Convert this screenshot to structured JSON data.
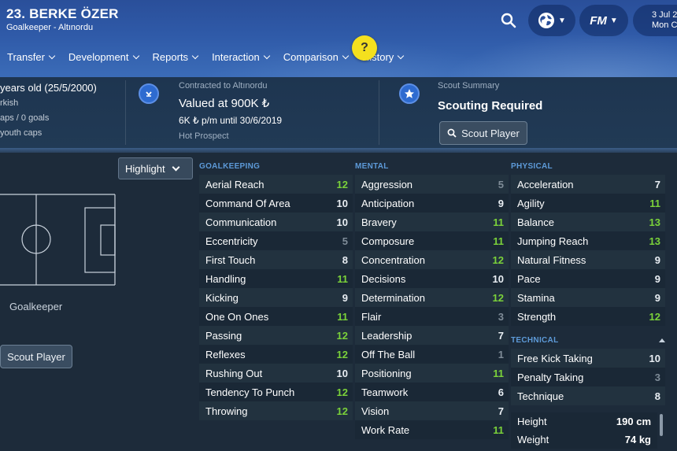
{
  "header": {
    "player_name": "23. BERKE ÖZER",
    "player_sub": "Goalkeeper - Altınordu",
    "date_line1": "3 Jul 2",
    "date_line2": "Mon C",
    "fm_label": "FM"
  },
  "nav": {
    "items": [
      "Transfer",
      "Development",
      "Reports",
      "Interaction",
      "Comparison",
      "History"
    ],
    "help": "?"
  },
  "info": {
    "age": "years old (25/5/2000)",
    "nationality": "rkish",
    "caps": "aps / 0 goals",
    "youth_caps": "youth caps",
    "contract_label": "Contracted to Altınordu",
    "value": "Valued at 900K ₺",
    "wage": "6K ₺ p/m until 30/6/2019",
    "status": "Hot Prospect",
    "scout_label": "Scout Summary",
    "scout_status": "Scouting Required",
    "scout_button": "Scout Player"
  },
  "left": {
    "highlight": "Highlight",
    "position": "Goalkeeper",
    "scout_button": "Scout Player"
  },
  "goalkeeping": {
    "title": "GOALKEEPING",
    "rows": [
      {
        "name": "Aerial Reach",
        "value": "12"
      },
      {
        "name": "Command Of Area",
        "value": "10"
      },
      {
        "name": "Communication",
        "value": "10"
      },
      {
        "name": "Eccentricity",
        "value": "5"
      },
      {
        "name": "First Touch",
        "value": "8"
      },
      {
        "name": "Handling",
        "value": "11"
      },
      {
        "name": "Kicking",
        "value": "9"
      },
      {
        "name": "One On Ones",
        "value": "11"
      },
      {
        "name": "Passing",
        "value": "12"
      },
      {
        "name": "Reflexes",
        "value": "12"
      },
      {
        "name": "Rushing Out",
        "value": "10"
      },
      {
        "name": "Tendency To Punch",
        "value": "12"
      },
      {
        "name": "Throwing",
        "value": "12"
      }
    ]
  },
  "mental": {
    "title": "MENTAL",
    "rows": [
      {
        "name": "Aggression",
        "value": "5"
      },
      {
        "name": "Anticipation",
        "value": "9"
      },
      {
        "name": "Bravery",
        "value": "11"
      },
      {
        "name": "Composure",
        "value": "11"
      },
      {
        "name": "Concentration",
        "value": "12"
      },
      {
        "name": "Decisions",
        "value": "10"
      },
      {
        "name": "Determination",
        "value": "12"
      },
      {
        "name": "Flair",
        "value": "3"
      },
      {
        "name": "Leadership",
        "value": "7"
      },
      {
        "name": "Off The Ball",
        "value": "1"
      },
      {
        "name": "Positioning",
        "value": "11"
      },
      {
        "name": "Teamwork",
        "value": "6"
      },
      {
        "name": "Vision",
        "value": "7"
      },
      {
        "name": "Work Rate",
        "value": "11"
      }
    ]
  },
  "physical": {
    "title": "PHYSICAL",
    "rows": [
      {
        "name": "Acceleration",
        "value": "7"
      },
      {
        "name": "Agility",
        "value": "11"
      },
      {
        "name": "Balance",
        "value": "13"
      },
      {
        "name": "Jumping Reach",
        "value": "13"
      },
      {
        "name": "Natural Fitness",
        "value": "9"
      },
      {
        "name": "Pace",
        "value": "9"
      },
      {
        "name": "Stamina",
        "value": "9"
      },
      {
        "name": "Strength",
        "value": "12"
      }
    ]
  },
  "technical": {
    "title": "TECHNICAL",
    "rows": [
      {
        "name": "Free Kick Taking",
        "value": "10"
      },
      {
        "name": "Penalty Taking",
        "value": "3"
      },
      {
        "name": "Technique",
        "value": "8"
      }
    ]
  },
  "body": {
    "height_label": "Height",
    "height_value": "190 cm",
    "weight_label": "Weight",
    "weight_value": "74 kg"
  },
  "colors": {
    "high": "#7bd23a",
    "mid": "#e9eef3",
    "low": "#7f8c98",
    "accent": "#5d9ad8"
  }
}
